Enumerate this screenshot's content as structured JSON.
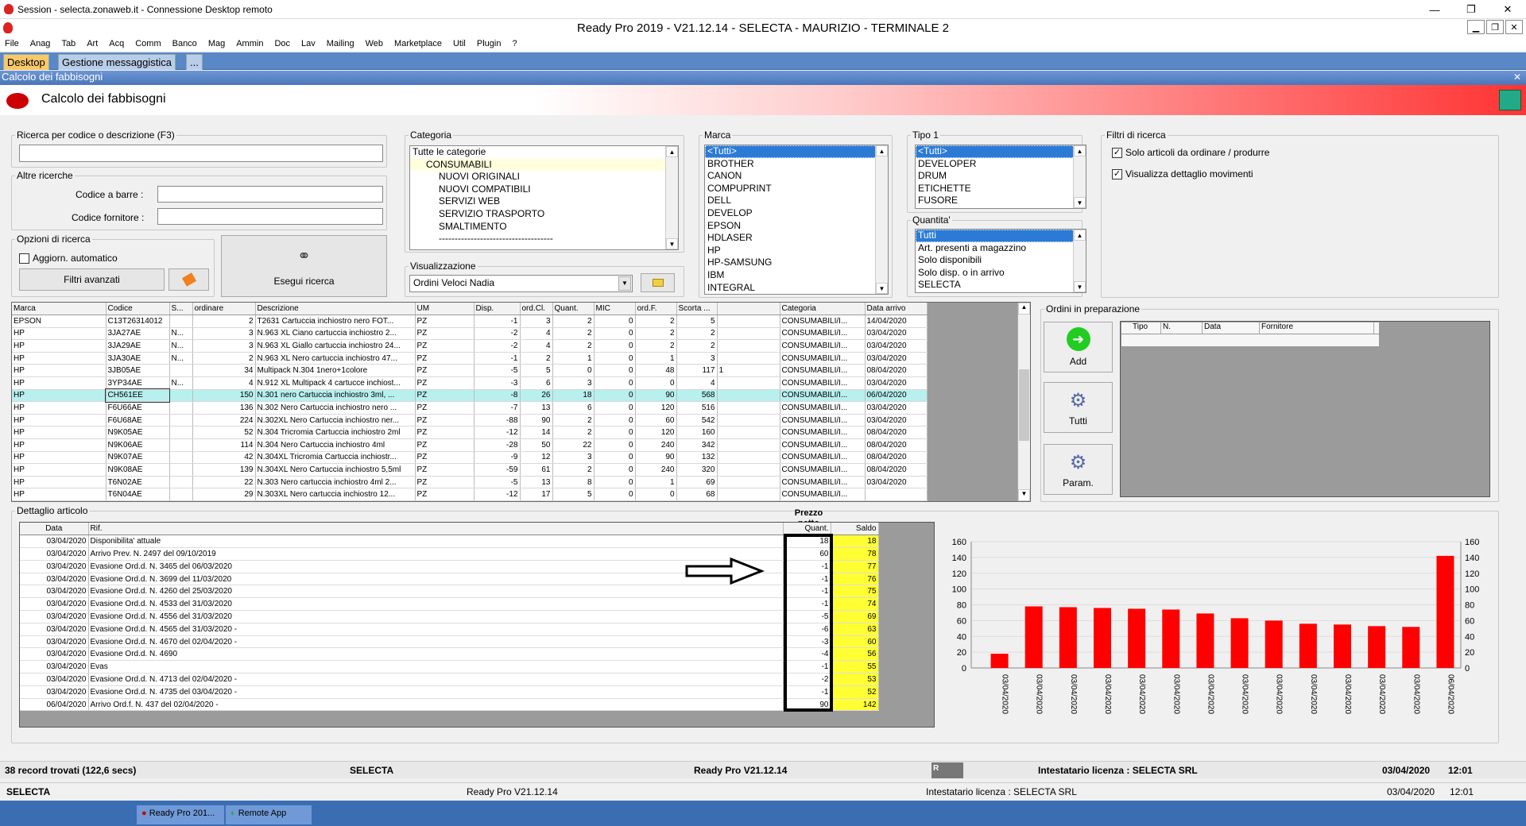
{
  "rdp": {
    "title": "Session - selecta.zonaweb.it - Connessione Desktop remoto"
  },
  "app": {
    "title": "Ready Pro 2019 - V21.12.14 - SELECTA - MAURIZIO - TERMINALE 2"
  },
  "menu": [
    "File",
    "Anag",
    "Tab",
    "Art",
    "Acq",
    "Comm",
    "Banco",
    "Mag",
    "Ammin",
    "Doc",
    "Lav",
    "Mailing",
    "Web",
    "Marketplace",
    "Util",
    "Plugin",
    "?"
  ],
  "tabs": [
    "Desktop",
    "Gestione messaggistica",
    "..."
  ],
  "window": {
    "caption": "Calcolo dei fabbisogni",
    "header_title": "Calcolo dei fabbisogni"
  },
  "search": {
    "legend": "Ricerca per codice o descrizione (F3)",
    "value": ""
  },
  "altre": {
    "legend": "Altre ricerche",
    "barcode_label": "Codice a barre :",
    "supplier_label": "Codice fornitore :"
  },
  "opzioni": {
    "legend": "Opzioni di ricerca",
    "auto_label": "Aggiorn. automatico",
    "auto_checked": false,
    "filtri_label": "Filtri avanzati",
    "esegui_label": "Esegui ricerca"
  },
  "categoria": {
    "legend": "Categoria",
    "items": [
      "Tutte le categorie",
      "CONSUMABILI",
      "NUOVI ORIGINALI",
      "NUOVI COMPATIBILI",
      "SERVIZI WEB",
      "SERVIZIO TRASPORTO",
      "SMALTIMENTO",
      "------------------------------------"
    ]
  },
  "visualizzazione": {
    "legend": "Visualizzazione",
    "value": "Ordini Veloci Nadia"
  },
  "marca": {
    "legend": "Marca",
    "items": [
      "<Tutti>",
      "BROTHER",
      "CANON",
      "COMPUPRINT",
      "DELL",
      "DEVELOP",
      "EPSON",
      "HDLASER",
      "HP",
      "HP-SAMSUNG",
      "IBM",
      "INTEGRAL"
    ]
  },
  "tipo1": {
    "legend": "Tipo 1",
    "items": [
      "<Tutti>",
      "DEVELOPER",
      "DRUM",
      "ETICHETTE",
      "FUSORE"
    ]
  },
  "quantita": {
    "legend": "Quantita'",
    "items": [
      "Tutti",
      "Art. presenti a magazzino",
      "Solo disponibili",
      "Solo disp. o in arrivo",
      "SELECTA"
    ]
  },
  "filtri": {
    "legend": "Filtri di ricerca",
    "opt1": "Solo articoli da ordinare / produrre",
    "opt2": "Visualizza dettaglio movimenti"
  },
  "grid": {
    "headers": [
      "Marca",
      "Codice",
      "S...",
      "ordinare",
      "Descrizione",
      "UM",
      "Disp.",
      "ord.Cl.",
      "Quant.",
      "MIC",
      "ord.F.",
      "Scorta ...",
      "",
      "Categoria",
      "Data arrivo"
    ],
    "rows": [
      [
        "EPSON",
        "C13T26314012",
        "",
        "2",
        "T2631 Cartuccia inchiostro nero FOT...",
        "PZ",
        "-1",
        "3",
        "2",
        "0",
        "2",
        "5",
        "",
        "CONSUMABILI/I...",
        "14/04/2020"
      ],
      [
        "HP",
        "3JA27AE",
        "N...",
        "3",
        "N.963 XL Ciano cartuccia inchiostro 2...",
        "PZ",
        "-2",
        "4",
        "2",
        "0",
        "2",
        "2",
        "",
        "CONSUMABILI/I...",
        "03/04/2020"
      ],
      [
        "HP",
        "3JA29AE",
        "N...",
        "3",
        "N.963 XL Giallo cartuccia inchiostro 24...",
        "PZ",
        "-2",
        "4",
        "2",
        "0",
        "2",
        "2",
        "",
        "CONSUMABILI/I...",
        "03/04/2020"
      ],
      [
        "HP",
        "3JA30AE",
        "N...",
        "2",
        "N.963 XL Nero cartuccia inchiostro 47...",
        "PZ",
        "-1",
        "2",
        "1",
        "0",
        "1",
        "3",
        "",
        "CONSUMABILI/I...",
        "03/04/2020"
      ],
      [
        "HP",
        "3JB05AE",
        "",
        "34",
        "Multipack N.304 1nero+1colore",
        "PZ",
        "-5",
        "5",
        "0",
        "0",
        "48",
        "117",
        "1",
        "CONSUMABILI/I...",
        "08/04/2020"
      ],
      [
        "HP",
        "3YP34AE",
        "N...",
        "4",
        "N.912 XL Multipack 4 cartucce inchiost...",
        "PZ",
        "-3",
        "6",
        "3",
        "0",
        "0",
        "4",
        "",
        "CONSUMABILI/I...",
        "03/04/2020"
      ],
      [
        "HP",
        "CH561EE",
        "",
        "150",
        "N.301 nero Cartuccia inchiostro 3ml, ...",
        "PZ",
        "-8",
        "26",
        "18",
        "0",
        "90",
        "568",
        "",
        "CONSUMABILI/I...",
        "06/04/2020"
      ],
      [
        "HP",
        "F6U66AE",
        "",
        "136",
        "N.302 Nero Cartuccia inchiostro nero ...",
        "PZ",
        "-7",
        "13",
        "6",
        "0",
        "120",
        "516",
        "",
        "CONSUMABILI/I...",
        "03/04/2020"
      ],
      [
        "HP",
        "F6U68AE",
        "",
        "224",
        "N.302XL Nero Cartuccia inchiostro ner...",
        "PZ",
        "-88",
        "90",
        "2",
        "0",
        "60",
        "542",
        "",
        "CONSUMABILI/I...",
        "03/04/2020"
      ],
      [
        "HP",
        "N9K05AE",
        "",
        "52",
        "N.304 Tricromia Cartuccia inchiostro 2ml",
        "PZ",
        "-12",
        "14",
        "2",
        "0",
        "120",
        "160",
        "",
        "CONSUMABILI/I...",
        "08/04/2020"
      ],
      [
        "HP",
        "N9K06AE",
        "",
        "114",
        "N.304 Nero Cartuccia inchiostro 4ml",
        "PZ",
        "-28",
        "50",
        "22",
        "0",
        "240",
        "342",
        "",
        "CONSUMABILI/I...",
        "08/04/2020"
      ],
      [
        "HP",
        "N9K07AE",
        "",
        "42",
        "N.304XL Tricromia Cartuccia inchiostr...",
        "PZ",
        "-9",
        "12",
        "3",
        "0",
        "90",
        "132",
        "",
        "CONSUMABILI/I...",
        "08/04/2020"
      ],
      [
        "HP",
        "N9K08AE",
        "",
        "139",
        "N.304XL Nero Cartuccia inchiostro 5,5ml",
        "PZ",
        "-59",
        "61",
        "2",
        "0",
        "240",
        "320",
        "",
        "CONSUMABILI/I...",
        "08/04/2020"
      ],
      [
        "HP",
        "T6N02AE",
        "",
        "22",
        "N.303 Nero cartuccia inchiostro 4ml 2...",
        "PZ",
        "-5",
        "13",
        "8",
        "0",
        "1",
        "69",
        "",
        "CONSUMABILI/I...",
        "03/04/2020"
      ],
      [
        "HP",
        "T6N04AE",
        "",
        "29",
        "N.303XL Nero cartuccia inchiostro 12...",
        "PZ",
        "-12",
        "17",
        "5",
        "0",
        "0",
        "68",
        "",
        "CONSUMABILI/I...",
        ""
      ]
    ],
    "highlight_row": 6
  },
  "ordini": {
    "legend": "Ordini in preparazione",
    "add": "Add",
    "tutti": "Tutti",
    "param": "Param.",
    "headers": [
      "Tipo",
      "N.",
      "Data",
      "Fornitore"
    ]
  },
  "dettaglio": {
    "legend": "Dettaglio articolo",
    "prezzo_label": "Prezzo netto",
    "headers": [
      "Data",
      "Rif.",
      "Quant.",
      "Saldo"
    ],
    "rows": [
      [
        "03/04/2020",
        "Disponibilita' attuale",
        "18",
        "18"
      ],
      [
        "03/04/2020",
        "Arrivo Prev. N. 2497 del 09/10/2019",
        "60",
        "78"
      ],
      [
        "03/04/2020",
        "Evasione Ord.d. N. 3465 del 06/03/2020",
        "-1",
        "77"
      ],
      [
        "03/04/2020",
        "Evasione Ord.d. N. 3699 del 11/03/2020",
        "-1",
        "76"
      ],
      [
        "03/04/2020",
        "Evasione Ord.d. N. 4260 del 25/03/2020",
        "-1",
        "75"
      ],
      [
        "03/04/2020",
        "Evasione Ord.d. N. 4533 del 31/03/2020",
        "-1",
        "74"
      ],
      [
        "03/04/2020",
        "Evasione Ord.d. N. 4556 del 31/03/2020",
        "-5",
        "69"
      ],
      [
        "03/04/2020",
        "Evasione Ord.d. N. 4565 del 31/03/2020 -",
        "-6",
        "63"
      ],
      [
        "03/04/2020",
        "Evasione Ord.d. N. 4670 del 02/04/2020 -",
        "-3",
        "60"
      ],
      [
        "03/04/2020",
        "Evasione Ord.d. N. 4690",
        "-4",
        "56"
      ],
      [
        "03/04/2020",
        "Evas",
        "-1",
        "55"
      ],
      [
        "03/04/2020",
        "Evasione Ord.d. N. 4713 del 02/04/2020 -",
        "-2",
        "53"
      ],
      [
        "03/04/2020",
        "Evasione Ord.d. N. 4735 del 03/04/2020 -",
        "-1",
        "52"
      ],
      [
        "06/04/2020",
        "Arrivo Ord.f. N. 437 del 02/04/2020 -",
        "90",
        "142"
      ]
    ]
  },
  "chart_data": {
    "type": "bar",
    "categories": [
      "03/04/2020",
      "03/04/2020",
      "03/04/2020",
      "03/04/2020",
      "03/04/2020",
      "03/04/2020",
      "03/04/2020",
      "03/04/2020",
      "03/04/2020",
      "03/04/2020",
      "03/04/2020",
      "03/04/2020",
      "03/04/2020",
      "06/04/2020"
    ],
    "values": [
      18,
      78,
      77,
      76,
      75,
      74,
      69,
      63,
      60,
      56,
      55,
      53,
      52,
      142
    ],
    "ylim": [
      0,
      160
    ],
    "yticks": [
      0,
      20,
      40,
      60,
      80,
      100,
      120,
      140,
      160
    ],
    "color": "#ff0000",
    "grid": true
  },
  "status": {
    "records": "38 record trovati (122,6 secs)",
    "company": "SELECTA",
    "version": "Ready Pro V21.12.14",
    "license": "Intestatario licenza : SELECTA SRL",
    "date": "03/04/2020",
    "time": "12:01",
    "icon_label": "R"
  },
  "status2": {
    "company": "SELECTA",
    "version": "Ready Pro V21.12.14",
    "license": "Intestatario licenza : SELECTA SRL",
    "date": "03/04/2020",
    "time": "12:01"
  },
  "taskbar": {
    "item1": "Ready Pro 201...",
    "item2": "Remote App"
  }
}
